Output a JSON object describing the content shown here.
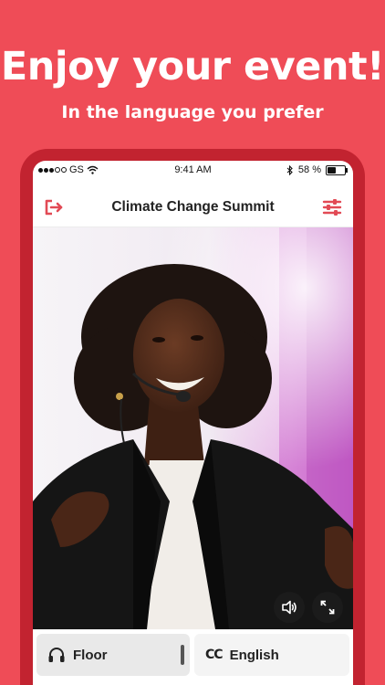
{
  "promo": {
    "headline": "Enjoy your event!",
    "subheadline": "In the language you prefer"
  },
  "status_bar": {
    "carrier": "GS",
    "time": "9:41 AM",
    "battery": "58 %",
    "battery_level": 0.58
  },
  "app_bar": {
    "title": "Climate Change Summit",
    "exit_icon": "exit-icon",
    "settings_icon": "sliders-icon"
  },
  "video": {
    "controls": [
      "volume-icon",
      "fullscreen-icon"
    ]
  },
  "channels": {
    "floor_label": "Floor",
    "floor_icon": "headphones-icon",
    "language_badge": "CC",
    "language_label": "English"
  },
  "colors": {
    "brand": "#ef4c57",
    "phone_frame": "#c22330"
  }
}
